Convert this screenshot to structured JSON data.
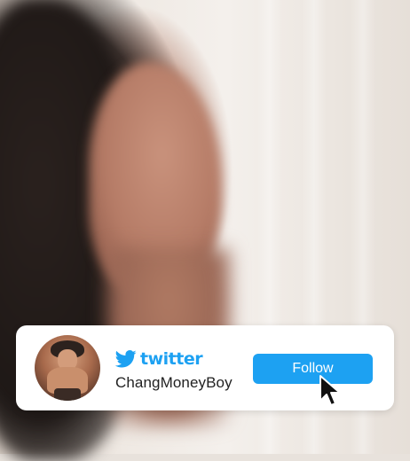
{
  "card": {
    "brand_name": "twitter",
    "username": "ChangMoneyBoy",
    "follow_label": "Follow"
  },
  "colors": {
    "accent": "#1da1f2",
    "card_background": "#ffffff",
    "username_text": "#222222"
  },
  "icons": {
    "brand_icon": "twitter-bird-icon",
    "cursor_icon": "mouse-pointer-icon",
    "avatar": "profile-avatar"
  }
}
